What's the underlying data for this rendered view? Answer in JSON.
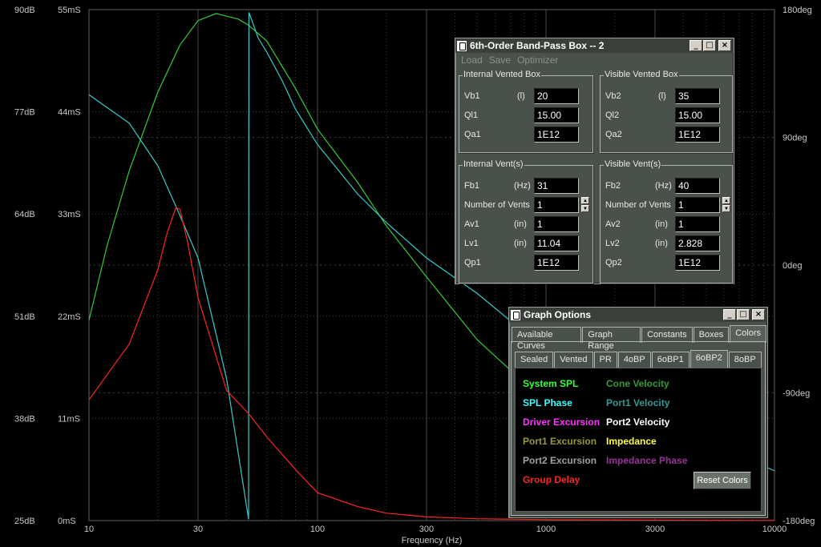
{
  "plot": {
    "xlabel": "Frequency (Hz)",
    "x_ticks": [
      "10",
      "30",
      "100",
      "300",
      "1000",
      "3000",
      "10000"
    ],
    "spl_ticks": [
      "90dB",
      "77dB",
      "64dB",
      "51dB",
      "38dB",
      "25dB"
    ],
    "delay_ticks": [
      "55mS",
      "44mS",
      "33mS",
      "22mS",
      "11mS",
      "0mS"
    ],
    "phase_ticks": [
      "180deg",
      "90deg",
      "0deg",
      "-90deg",
      "-180deg"
    ]
  },
  "chart_data": {
    "type": "line",
    "x_scale": "log",
    "xlim": [
      10,
      10000
    ],
    "xlabel": "Frequency (Hz)",
    "y_left_spl_db": [
      25,
      90
    ],
    "y_left_delay_ms": [
      0,
      55
    ],
    "y_right_phase_deg": [
      -180,
      180
    ],
    "series": [
      {
        "name": "System SPL",
        "color": "#33cc33",
        "axis": "spl",
        "x": [
          10,
          12,
          15,
          20,
          25,
          30,
          36,
          45,
          50,
          60,
          80,
          100,
          150,
          200,
          300,
          500,
          1000
        ],
        "y": [
          50.5,
          60,
          69.5,
          79.5,
          85.5,
          88.6,
          89.5,
          88.8,
          88,
          86,
          80,
          74.8,
          68,
          62.5,
          56,
          48,
          40
        ]
      },
      {
        "name": "SPL Phase",
        "color": "#33cccc",
        "axis": "phase",
        "x": [
          10,
          15,
          20,
          25,
          30,
          40,
          49.9,
          50.1,
          55,
          60,
          70,
          80,
          100,
          150,
          200,
          300,
          500,
          1000,
          3000,
          10000
        ],
        "y": [
          120,
          100,
          70,
          35,
          5,
          -80,
          -179,
          178,
          160,
          150,
          130,
          110,
          85,
          50,
          30,
          5,
          -20,
          -60,
          -105,
          -145
        ]
      },
      {
        "name": "Group Delay",
        "color": "#ff2222",
        "axis": "delay",
        "x": [
          10,
          15,
          20,
          22,
          24,
          25,
          27,
          30,
          40,
          50,
          60,
          80,
          100,
          150,
          200,
          300,
          500,
          1000,
          3000,
          10000
        ],
        "y": [
          13,
          19,
          27,
          31,
          33.7,
          33.5,
          30,
          24,
          14,
          11.5,
          9,
          5.5,
          3,
          1.5,
          0.8,
          0.4,
          0.2,
          0.1,
          0.05,
          0.02
        ]
      }
    ]
  },
  "bp_window": {
    "title": "6th-Order Band-Pass Box -- 2",
    "menu": [
      "Load",
      "Save",
      "Optimizer"
    ],
    "internal_box": {
      "legend": "Internal Vented Box",
      "rows": [
        {
          "label": "Vb1",
          "unit": "(l)",
          "value": "20"
        },
        {
          "label": "Ql1",
          "unit": "",
          "value": "15.00"
        },
        {
          "label": "Qa1",
          "unit": "",
          "value": "1E12"
        }
      ]
    },
    "visible_box": {
      "legend": "Visible Vented Box",
      "rows": [
        {
          "label": "Vb2",
          "unit": "(l)",
          "value": "35"
        },
        {
          "label": "Ql2",
          "unit": "",
          "value": "15.00"
        },
        {
          "label": "Qa2",
          "unit": "",
          "value": "1E12"
        }
      ]
    },
    "internal_vent": {
      "legend": "Internal Vent(s)",
      "rows": [
        {
          "label": "Fb1",
          "unit": "(Hz)",
          "value": "31"
        },
        {
          "label": "Number of Vents",
          "unit": "",
          "value": "1"
        },
        {
          "label": "Av1",
          "unit": "(in)",
          "value": "1"
        },
        {
          "label": "Lv1",
          "unit": "(in)",
          "value": "11.04"
        },
        {
          "label": "Qp1",
          "unit": "",
          "value": "1E12"
        }
      ]
    },
    "visible_vent": {
      "legend": "Visible Vent(s)",
      "rows": [
        {
          "label": "Fb2",
          "unit": "(Hz)",
          "value": "40"
        },
        {
          "label": "Number of Vents",
          "unit": "",
          "value": "1"
        },
        {
          "label": "Av2",
          "unit": "(in)",
          "value": "1"
        },
        {
          "label": "Lv2",
          "unit": "(in)",
          "value": "2.828"
        },
        {
          "label": "Qp2",
          "unit": "",
          "value": "1E12"
        }
      ]
    }
  },
  "graph_options": {
    "title": "Graph Options",
    "tabs": [
      "Available Curves",
      "Graph Range",
      "Constants",
      "Boxes",
      "Colors"
    ],
    "active_tab": "Colors",
    "subtabs": [
      "Sealed",
      "Vented",
      "PR",
      "4oBP",
      "6oBP1",
      "6oBP2",
      "8oBP"
    ],
    "active_subtab": "6oBP2",
    "colors_left": [
      {
        "label": "System SPL",
        "color": "#33ff33"
      },
      {
        "label": "SPL Phase",
        "color": "#33ffff"
      },
      {
        "label": "Driver Excursion",
        "color": "#ff33ff"
      },
      {
        "label": "Port1 Excursion",
        "color": "#999933"
      },
      {
        "label": "Port2 Excursion",
        "color": "#a0a0a0"
      },
      {
        "label": "Group Delay",
        "color": "#ff2222"
      }
    ],
    "colors_right": [
      {
        "label": "Cone Velocity",
        "color": "#339933"
      },
      {
        "label": "Port1 Velocity",
        "color": "#339999"
      },
      {
        "label": "Port2 Velocity",
        "color": "#ffffff"
      },
      {
        "label": "Impedance",
        "color": "#ffff33"
      },
      {
        "label": "Impedance Phase",
        "color": "#993399"
      }
    ],
    "reset_label": "Reset Colors"
  }
}
